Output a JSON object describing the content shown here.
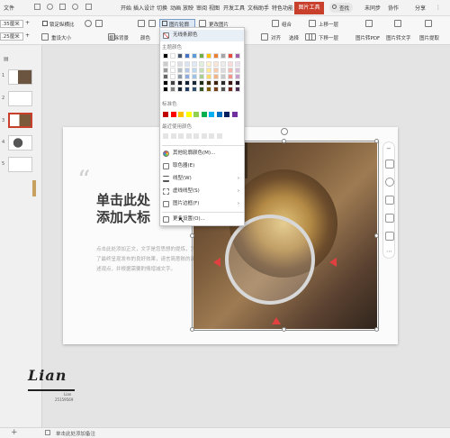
{
  "menubar": {
    "file": "文件",
    "tabs": [
      "开始",
      "插入",
      "设计",
      "切换",
      "动画",
      "放映",
      "审阅",
      "视图",
      "开发工具",
      "文档助手",
      "特色功能"
    ],
    "active_tab": "图片工具",
    "search": "查找",
    "unsynced": "未同步",
    "collab": "协作",
    "share": "分享"
  },
  "ribbon": {
    "size1": ".35厘米",
    "size2": ".25厘米",
    "lock_ratio": "锁定纵横比",
    "reset_size": "重设大小",
    "img_outline": "图片轮廓",
    "change_img": "更改图片",
    "remove_bg": "抠除背景",
    "color": "颜色",
    "group": "组合",
    "align": "对齐",
    "select": "选择",
    "bring_forward": "上移一层",
    "send_backward": "下移一层",
    "to_pdf": "图片转PDF",
    "to_text": "图片转文字",
    "extract": "图片提取"
  },
  "dropdown": {
    "no_outline": "无线条颜色",
    "theme_colors": "主题颜色",
    "standard_colors": "标准色",
    "recent_colors": "最近使用颜色",
    "more_colors": "其他轮廓颜色(M)...",
    "eyedropper": "取色器(E)",
    "line_weight": "线型(W)",
    "dash_type": "虚线线型(S)",
    "img_border": "图片边框(F)",
    "more_settings": "更多设置(O)..."
  },
  "slide": {
    "title_line1": "单击此处",
    "title_line2": "添加大标",
    "quote_mark": "“",
    "body_text": "点击此处添加正文，文字是您思想的提炼，为了最终呈现发布的良好效果，请言简意赅的阐述观点，并根据需要酌情增减文字。"
  },
  "slides_panel": {
    "numbers": [
      "1",
      "2",
      "3",
      "4",
      "5"
    ]
  },
  "signature": {
    "name": "Lian",
    "sub": "Lian",
    "id": "25159569"
  },
  "statusbar": {
    "notes": "单击此处添加备注",
    "add": "+"
  },
  "colors": {
    "theme_row": [
      "#000000",
      "#ffffff",
      "#44546a",
      "#4472c4",
      "#5b9bd5",
      "#70ad47",
      "#ffc000",
      "#ed7d31",
      "#a5a5a5",
      "#e84c3d",
      "#9e5ea8"
    ],
    "standard": [
      "#c00000",
      "#ff0000",
      "#ffc000",
      "#ffff00",
      "#92d050",
      "#00b050",
      "#00b0f0",
      "#0070c0",
      "#002060",
      "#7030a0"
    ],
    "accent": "#c8402c"
  }
}
